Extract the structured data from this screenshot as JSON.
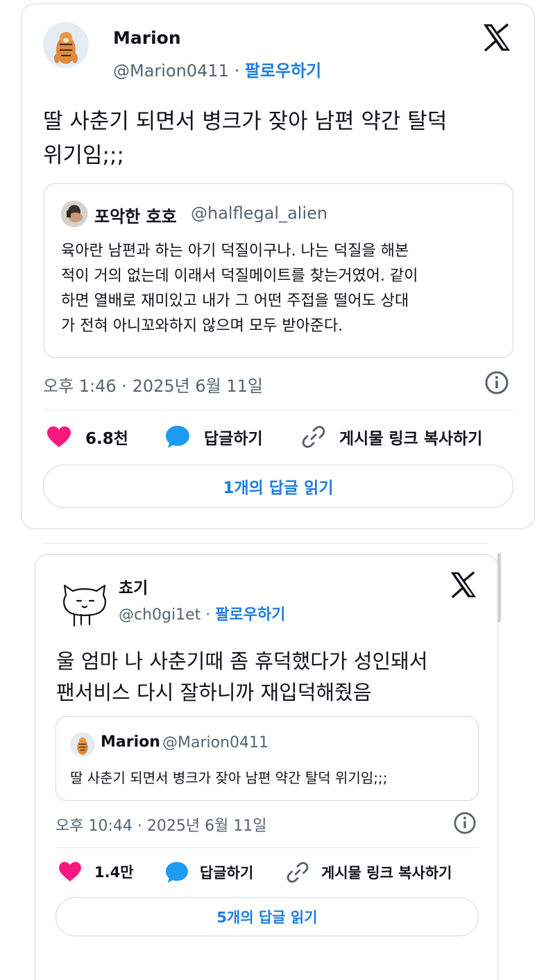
{
  "tweet1": {
    "author_name": "Marion",
    "author_handle": "@Marion0411",
    "follow_label": "팔로우하기",
    "text_line1": "딸 사춘기 되면서 병크가 잦아 남편 약간 탈덕",
    "text_line2": "위기임;;;",
    "quote": {
      "author_name": "포악한 호호",
      "author_handle": "@halflegal_alien",
      "lines": [
        "육아란 남편과 하는 아기 덕질이구나. 나는 덕질을 해본",
        "적이 거의 없는데 이래서 덕질메이트를 찾는거였어. 같이",
        "하면 열배로 재미있고 내가 그 어떤 주접을 떨어도 상대",
        "가 전혀 아니꼬와하지 않으며 모두 받아준다."
      ]
    },
    "timestamp": "오후 1:46 · 2025년 6월 11일",
    "like_count": "6.8천",
    "reply_label": "답글하기",
    "copy_link_label": "게시물 링크 복사하기",
    "read_replies_label": "1개의 답글 읽기"
  },
  "tweet2": {
    "author_name": "쵸기",
    "author_handle": "@ch0gi1et",
    "follow_label": "팔로우하기",
    "text_line1": "울 엄마 나 사춘기때 좀 휴덕했다가 성인돼서",
    "text_line2": "팬서비스 다시 잘하니까 재입덕해줬음",
    "quote": {
      "author_name": "Marion",
      "author_handle": "@Marion0411",
      "text": "딸 사춘기 되면서 병크가 잦아 남편 약간 탈덕 위기임;;;"
    },
    "timestamp": "오후 10:44 · 2025년 6월 11일",
    "like_count": "1.4만",
    "reply_label": "답글하기",
    "copy_link_label": "게시물 링크 복사하기",
    "read_replies_label": "5개의 답글 읽기"
  },
  "colors": {
    "accent": "#1d7ce2",
    "like": "#f91880",
    "reply": "#1d9bf0",
    "muted": "#536471",
    "border": "#cfd9de"
  },
  "icons": [
    "tiger-avatar",
    "x-logo-icon",
    "info-icon",
    "heart-icon",
    "reply-bubble-icon",
    "link-icon",
    "cat-doodle-avatar"
  ]
}
